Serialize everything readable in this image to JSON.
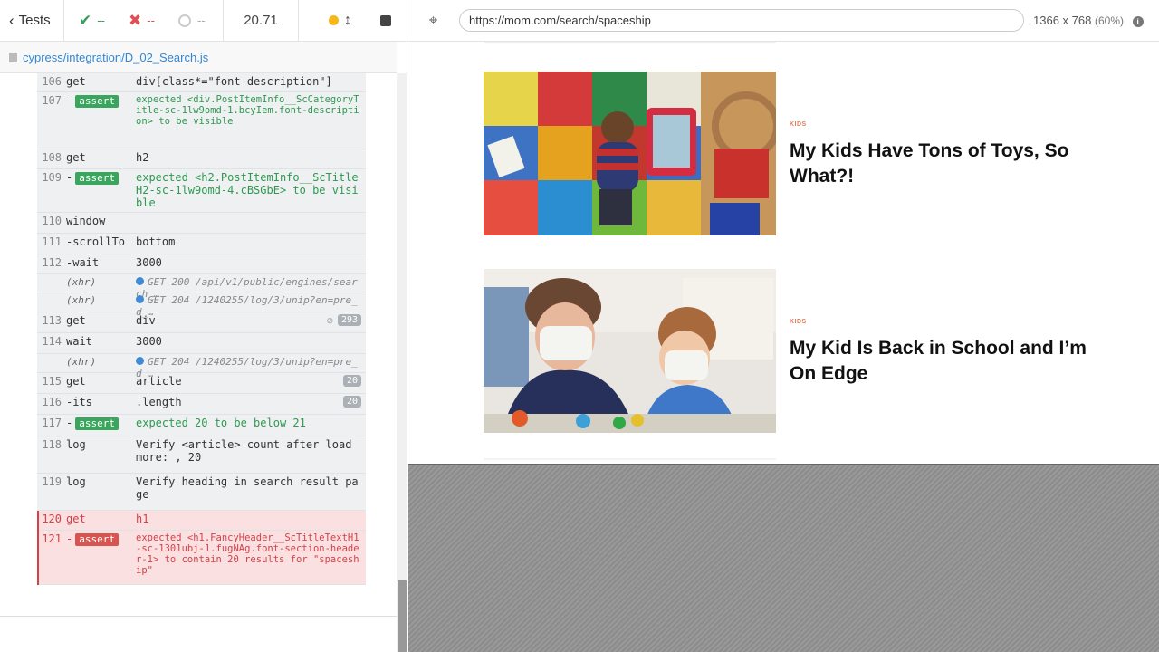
{
  "header": {
    "tests_label": "Tests",
    "passed": "--",
    "failed": "--",
    "pending": "--",
    "duration": "20.71"
  },
  "spec": {
    "path": "cypress/integration/D_02_Search.js"
  },
  "commands": [
    {
      "num": "106",
      "name": "get",
      "msg": "div[class*=\"font-description\"]"
    },
    {
      "num": "107",
      "name": "-",
      "badge": "assert",
      "msg": "expected <div.PostItemInfo__ScCategoryTitle-sc-1lw9omd-1.bcyIem.font-description> to be visible"
    },
    {
      "num": "108",
      "name": "get",
      "msg": "h2"
    },
    {
      "num": "109",
      "name": "-",
      "badge": "assert",
      "msg": "expected <h2.PostItemInfo__ScTitleH2-sc-1lw9omd-4.cBSGbE> to be visible"
    },
    {
      "num": "110",
      "name": "window",
      "msg": ""
    },
    {
      "num": "111",
      "name": "-scrollTo",
      "msg": "bottom"
    },
    {
      "num": "112",
      "name": "-wait",
      "msg": "3000"
    },
    {
      "num": "",
      "name": "(xhr)",
      "xhr": true,
      "msg": "GET 200 /api/v1/public/engines/search_…"
    },
    {
      "num": "",
      "name": "(xhr)",
      "xhr": true,
      "msg": "GET 204 /1240255/log/3/unip?en=pre_d_…"
    },
    {
      "num": "113",
      "name": "get",
      "msg": "div",
      "count": "293"
    },
    {
      "num": "114",
      "name": "wait",
      "msg": "3000"
    },
    {
      "num": "",
      "name": "(xhr)",
      "xhr": true,
      "msg": "GET 204 /1240255/log/3/unip?en=pre_d_…"
    },
    {
      "num": "115",
      "name": "get",
      "msg": "article",
      "count": "20"
    },
    {
      "num": "116",
      "name": "-its",
      "msg": ".length",
      "count": "20"
    },
    {
      "num": "117",
      "name": "-",
      "badge": "assert",
      "msg": "expected 20 to be below 21"
    },
    {
      "num": "118",
      "name": "log",
      "msg": "Verify <article> count after load more: , 20"
    },
    {
      "num": "119",
      "name": "log",
      "msg": "Verify heading in search result page"
    },
    {
      "num": "120",
      "name": "get",
      "msg": "h1",
      "failed": true
    },
    {
      "num": "121",
      "name": "-",
      "badge": "assert",
      "failed": true,
      "msg": "expected <h1.FancyHeader__ScTitleTextH1-sc-1301ubj-1.fugNAg.font-section-header-1> to contain 20 results for \"spaceship\""
    }
  ],
  "app": {
    "url": "https://mom.com/search/spaceship",
    "viewport": "1366 x 768",
    "scale": "(60%)",
    "info": "i"
  },
  "articles": [
    {
      "category": "KIDS",
      "title": "My Kids Have Tons of Toys, So What?!"
    },
    {
      "category": "KIDS",
      "title": "My Kid Is Back in School and I’m On Edge"
    }
  ],
  "icons": {
    "back": "chevron-left-icon",
    "pass": "check-icon",
    "fail": "x-icon",
    "pending": "circle-icon",
    "selector": "crosshair-icon"
  },
  "colors": {
    "pass": "#3a9e5f",
    "fail": "#e04f55",
    "link": "#3386d4",
    "category": "#e07c5a"
  }
}
